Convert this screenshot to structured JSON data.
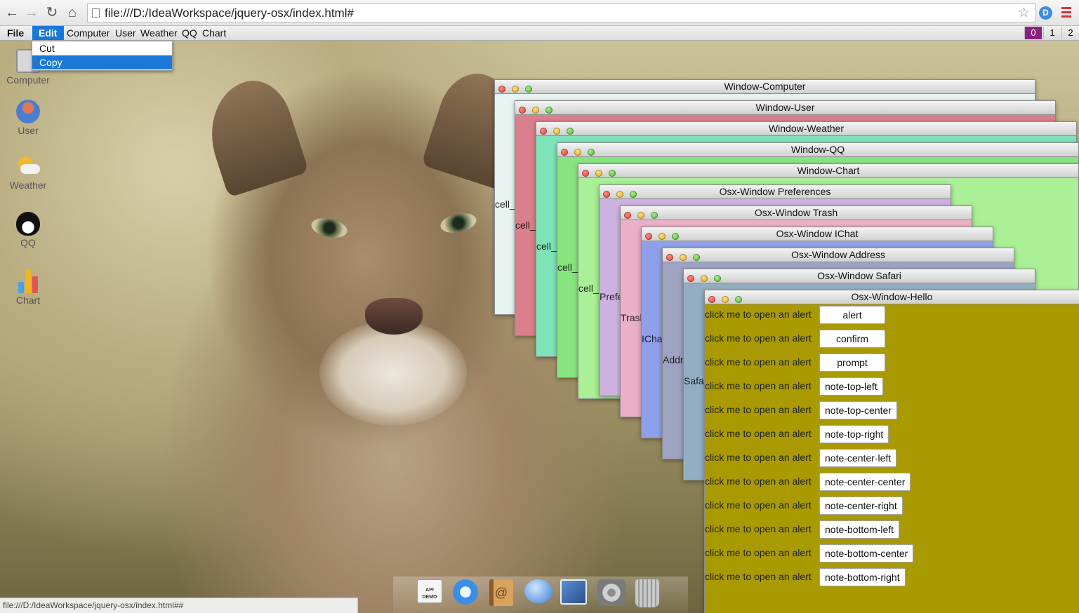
{
  "browser": {
    "url": "file:///D:/IdeaWorkspace/jquery-osx/index.html#",
    "status_url": "file:///D:/IdeaWorkspace/jquery-osx/index.html##"
  },
  "menubar": {
    "file": "File",
    "edit": "Edit",
    "items": [
      "Computer",
      "User",
      "Weather",
      "QQ",
      "Chart"
    ],
    "workspaces": [
      "0",
      "1",
      "2"
    ],
    "active_workspace": "0"
  },
  "edit_menu": {
    "items": [
      "Cut",
      "Copy"
    ],
    "selected": "Copy"
  },
  "desktop_icons": [
    "Computer",
    "User",
    "Weather",
    "QQ",
    "Chart"
  ],
  "windows": {
    "computer": {
      "title": "Window-Computer",
      "cell": "cell_100",
      "color": "#e6f3f0"
    },
    "user": {
      "title": "Window-User",
      "cell": "cell_101",
      "color": "#d9808c"
    },
    "weather": {
      "title": "Window-Weather",
      "cell": "cell_102",
      "color": "#7fe3b8"
    },
    "qq": {
      "title": "Window-QQ",
      "cell": "cell_103",
      "color": "#86e57e"
    },
    "chart": {
      "title": "Window-Chart",
      "cell": "cell_104",
      "color": "#a9f096"
    },
    "preferences": {
      "title": "Osx-Window Preferences",
      "cell": "Preferences",
      "color": "#cdb1e1"
    },
    "trash": {
      "title": "Osx-Window Trash",
      "cell": "Trash",
      "color": "#ebb0c8"
    },
    "ichat": {
      "title": "Osx-Window IChat",
      "cell": "IChat",
      "color": "#8fa0ea"
    },
    "address": {
      "title": "Osx-Window Address",
      "cell": "Address",
      "color": "#9fa3c2"
    },
    "safari": {
      "title": "Osx-Window Safari",
      "cell": "Safari",
      "color": "#93aec2"
    },
    "hello": {
      "title": "Osx-Window-Hello",
      "color": "#a89a00"
    }
  },
  "hello": {
    "label": "click me to open an alert",
    "buttons": [
      "alert",
      "confirm",
      "prompt",
      "note-top-left",
      "note-top-center",
      "note-top-right",
      "note-center-left",
      "note-center-center",
      "note-center-right",
      "note-bottom-left",
      "note-bottom-center",
      "note-bottom-right"
    ]
  },
  "dock": {
    "items": [
      "api-demo-icon",
      "safari-icon",
      "address-book-icon",
      "ichat-icon",
      "preview-icon",
      "preferences-icon",
      "trash-icon"
    ],
    "api_demo_label": "API DEMO"
  }
}
